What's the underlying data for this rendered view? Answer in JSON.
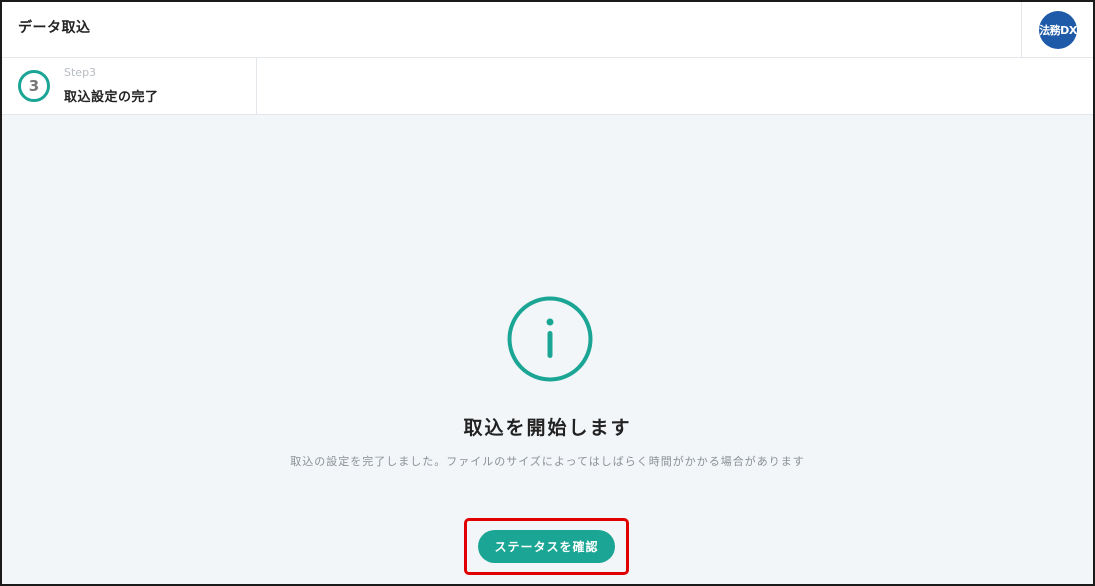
{
  "header": {
    "title": "データ取込",
    "brand_badge": "法務DX"
  },
  "step": {
    "number": "3",
    "label": "Step3",
    "name": "取込設定の完了"
  },
  "main": {
    "icon": "info-circle-icon",
    "title": "取込を開始します",
    "description": "取込の設定を完了しました。ファイルのサイズによってはしばらく時間がかかる場合があります",
    "button_label": "ステータスを確認"
  },
  "colors": {
    "accent": "#1aa594",
    "brand": "#1e5aa8",
    "highlight": "#e00000",
    "background": "#f3f6f9"
  }
}
